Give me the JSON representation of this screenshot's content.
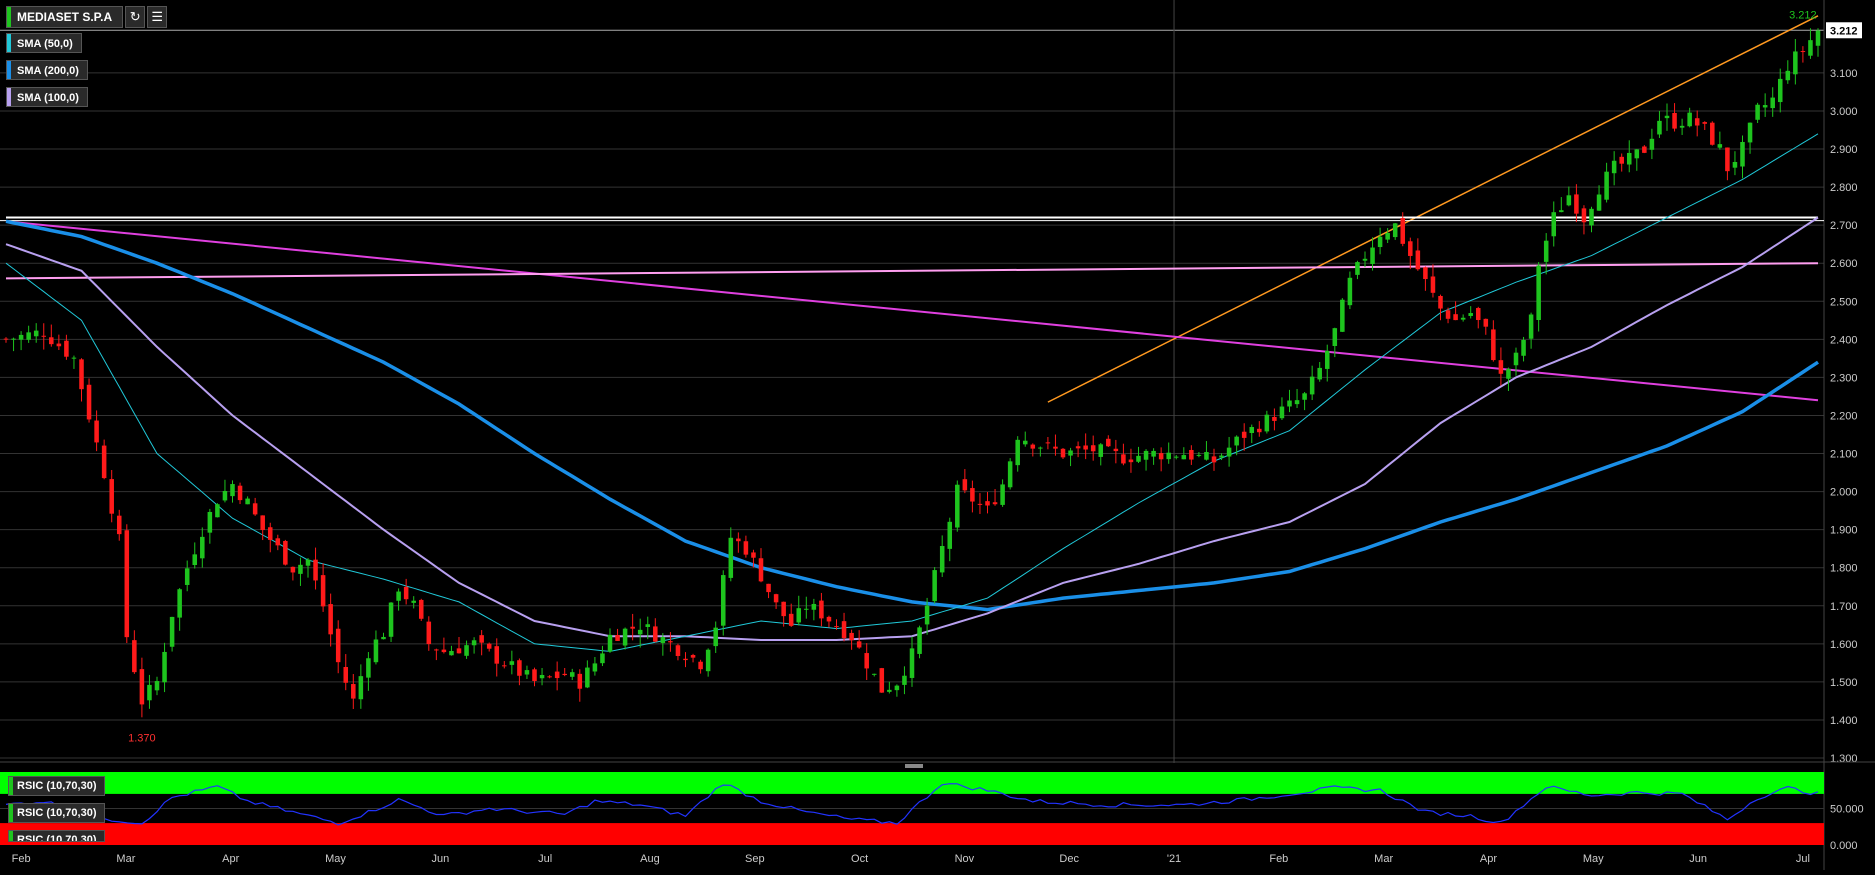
{
  "header": {
    "symbol": "MEDIASET S.P.A",
    "refresh_icon": "refresh-icon",
    "ruler_icon": "ruler-icon"
  },
  "legend": [
    {
      "label": "SMA (50,0)",
      "color": "#20c8d8"
    },
    {
      "label": "SMA (200,0)",
      "color": "#1a8fe8"
    },
    {
      "label": "SMA (100,0)",
      "color": "#b8a0f0"
    }
  ],
  "price_labels": {
    "last": "3.212",
    "high_marker": "3.212",
    "low_marker": "1.370"
  },
  "colors": {
    "up": "#1ec41e",
    "down": "#ff1a1a",
    "trend_up": "#ff9920",
    "trend_down": "#e040e0",
    "flat_line": "#ff9ef0",
    "resistance": "#ffffff",
    "rsi_line": "#2233ff",
    "rsi_overbought": "#00ff00",
    "rsi_oversold": "#ff0000"
  },
  "rsi_panel": {
    "labels": [
      "RSIC (10,70,30)",
      "RSIC (10,70,30)",
      "RSIC (10,70,30)"
    ],
    "axis": [
      "50.000",
      "0.000"
    ]
  },
  "chart_data": {
    "type": "candlestick",
    "yaxis_ticks": [
      "3.212",
      "3.100",
      "3.000",
      "2.900",
      "2.800",
      "2.700",
      "2.600",
      "2.500",
      "2.400",
      "2.300",
      "2.200",
      "2.100",
      "2.000",
      "1.900",
      "1.800",
      "1.700",
      "1.600",
      "1.500",
      "1.400",
      "1.300"
    ],
    "xaxis_ticks": [
      "Feb",
      "Mar",
      "Apr",
      "May",
      "Jun",
      "Jul",
      "Aug",
      "Sep",
      "Oct",
      "Nov",
      "Dec",
      "'21",
      "Feb",
      "Mar",
      "Apr",
      "May",
      "Jun",
      "Jul"
    ],
    "ylim": [
      1.3,
      3.26
    ],
    "close_path": [
      [
        0,
        2.4
      ],
      [
        5,
        2.42
      ],
      [
        9,
        2.35
      ],
      [
        11,
        2.2
      ],
      [
        13,
        2.05
      ],
      [
        15,
        1.87
      ],
      [
        16,
        1.62
      ],
      [
        18,
        1.45
      ],
      [
        20,
        1.5
      ],
      [
        22,
        1.68
      ],
      [
        24,
        1.8
      ],
      [
        26,
        1.9
      ],
      [
        28,
        1.98
      ],
      [
        30,
        2.02
      ],
      [
        32,
        1.97
      ],
      [
        34,
        1.9
      ],
      [
        36,
        1.85
      ],
      [
        38,
        1.8
      ],
      [
        40,
        1.82
      ],
      [
        42,
        1.7
      ],
      [
        44,
        1.55
      ],
      [
        46,
        1.45
      ],
      [
        48,
        1.58
      ],
      [
        50,
        1.63
      ],
      [
        52,
        1.75
      ],
      [
        54,
        1.7
      ],
      [
        56,
        1.6
      ],
      [
        58,
        1.58
      ],
      [
        62,
        1.6
      ],
      [
        66,
        1.55
      ],
      [
        70,
        1.5
      ],
      [
        74,
        1.52
      ],
      [
        76,
        1.5
      ],
      [
        78,
        1.55
      ],
      [
        80,
        1.62
      ],
      [
        84,
        1.65
      ],
      [
        88,
        1.6
      ],
      [
        92,
        1.55
      ],
      [
        94,
        1.65
      ],
      [
        96,
        1.88
      ],
      [
        98,
        1.85
      ],
      [
        100,
        1.78
      ],
      [
        102,
        1.7
      ],
      [
        104,
        1.65
      ],
      [
        106,
        1.7
      ],
      [
        108,
        1.68
      ],
      [
        110,
        1.65
      ],
      [
        112,
        1.62
      ],
      [
        114,
        1.55
      ],
      [
        116,
        1.48
      ],
      [
        118,
        1.5
      ],
      [
        120,
        1.57
      ],
      [
        122,
        1.7
      ],
      [
        124,
        1.85
      ],
      [
        126,
        2.0
      ],
      [
        128,
        1.98
      ],
      [
        130,
        1.95
      ],
      [
        132,
        2.02
      ],
      [
        134,
        2.15
      ],
      [
        136,
        2.13
      ],
      [
        140,
        2.1
      ],
      [
        144,
        2.11
      ],
      [
        148,
        2.09
      ],
      [
        152,
        2.1
      ],
      [
        156,
        2.1
      ],
      [
        160,
        2.08
      ],
      [
        164,
        2.15
      ],
      [
        168,
        2.2
      ],
      [
        172,
        2.25
      ],
      [
        174,
        2.32
      ],
      [
        176,
        2.42
      ],
      [
        178,
        2.55
      ],
      [
        180,
        2.62
      ],
      [
        182,
        2.68
      ],
      [
        184,
        2.7
      ],
      [
        186,
        2.62
      ],
      [
        188,
        2.55
      ],
      [
        190,
        2.48
      ],
      [
        192,
        2.45
      ],
      [
        194,
        2.47
      ],
      [
        196,
        2.42
      ],
      [
        198,
        2.3
      ],
      [
        200,
        2.35
      ],
      [
        202,
        2.45
      ],
      [
        203,
        2.6
      ],
      [
        205,
        2.72
      ],
      [
        207,
        2.78
      ],
      [
        209,
        2.72
      ],
      [
        211,
        2.8
      ],
      [
        213,
        2.85
      ],
      [
        215,
        2.87
      ],
      [
        217,
        2.9
      ],
      [
        219,
        2.98
      ],
      [
        221,
        2.97
      ],
      [
        223,
        2.98
      ],
      [
        225,
        2.95
      ],
      [
        227,
        2.9
      ],
      [
        228,
        2.85
      ],
      [
        230,
        2.9
      ],
      [
        232,
        3.0
      ],
      [
        234,
        3.03
      ],
      [
        236,
        3.12
      ],
      [
        238,
        3.16
      ],
      [
        240,
        3.212
      ]
    ],
    "sma50_path": [
      [
        0,
        2.6
      ],
      [
        10,
        2.45
      ],
      [
        20,
        2.1
      ],
      [
        30,
        1.93
      ],
      [
        40,
        1.82
      ],
      [
        50,
        1.77
      ],
      [
        60,
        1.71
      ],
      [
        70,
        1.6
      ],
      [
        80,
        1.58
      ],
      [
        90,
        1.62
      ],
      [
        100,
        1.66
      ],
      [
        110,
        1.64
      ],
      [
        120,
        1.66
      ],
      [
        130,
        1.72
      ],
      [
        140,
        1.85
      ],
      [
        150,
        1.97
      ],
      [
        160,
        2.08
      ],
      [
        170,
        2.16
      ],
      [
        180,
        2.32
      ],
      [
        190,
        2.47
      ],
      [
        200,
        2.55
      ],
      [
        210,
        2.62
      ],
      [
        220,
        2.72
      ],
      [
        230,
        2.82
      ],
      [
        240,
        2.94
      ]
    ],
    "sma100_path": [
      [
        0,
        2.65
      ],
      [
        10,
        2.58
      ],
      [
        20,
        2.38
      ],
      [
        30,
        2.2
      ],
      [
        40,
        2.05
      ],
      [
        50,
        1.9
      ],
      [
        60,
        1.76
      ],
      [
        70,
        1.66
      ],
      [
        80,
        1.62
      ],
      [
        90,
        1.62
      ],
      [
        100,
        1.61
      ],
      [
        110,
        1.61
      ],
      [
        120,
        1.62
      ],
      [
        130,
        1.68
      ],
      [
        140,
        1.76
      ],
      [
        150,
        1.81
      ],
      [
        160,
        1.87
      ],
      [
        170,
        1.92
      ],
      [
        180,
        2.02
      ],
      [
        190,
        2.18
      ],
      [
        200,
        2.3
      ],
      [
        210,
        2.38
      ],
      [
        220,
        2.49
      ],
      [
        230,
        2.59
      ],
      [
        240,
        2.72
      ]
    ],
    "sma200_path": [
      [
        0,
        2.71
      ],
      [
        10,
        2.67
      ],
      [
        20,
        2.6
      ],
      [
        30,
        2.52
      ],
      [
        40,
        2.43
      ],
      [
        50,
        2.34
      ],
      [
        60,
        2.23
      ],
      [
        70,
        2.1
      ],
      [
        80,
        1.98
      ],
      [
        90,
        1.87
      ],
      [
        100,
        1.8
      ],
      [
        110,
        1.75
      ],
      [
        120,
        1.71
      ],
      [
        130,
        1.69
      ],
      [
        140,
        1.72
      ],
      [
        150,
        1.74
      ],
      [
        160,
        1.76
      ],
      [
        170,
        1.79
      ],
      [
        180,
        1.85
      ],
      [
        190,
        1.92
      ],
      [
        200,
        1.98
      ],
      [
        210,
        2.05
      ],
      [
        220,
        2.12
      ],
      [
        230,
        2.21
      ],
      [
        240,
        2.34
      ]
    ],
    "trendlines": [
      {
        "name": "uptrend",
        "from": [
          138,
          2.235
        ],
        "to": [
          240,
          3.25
        ]
      },
      {
        "name": "downtrend",
        "from": [
          0,
          2.71
        ],
        "to": [
          240,
          2.24
        ]
      },
      {
        "name": "flat",
        "from": [
          0,
          2.56
        ],
        "to": [
          240,
          2.6
        ]
      },
      {
        "name": "resistance",
        "from": [
          0,
          2.72
        ],
        "to": [
          240,
          2.72
        ]
      }
    ],
    "rsi_path": [
      [
        0,
        55
      ],
      [
        5,
        60
      ],
      [
        10,
        45
      ],
      [
        14,
        35
      ],
      [
        18,
        30
      ],
      [
        22,
        65
      ],
      [
        28,
        80
      ],
      [
        32,
        60
      ],
      [
        38,
        45
      ],
      [
        44,
        30
      ],
      [
        48,
        45
      ],
      [
        52,
        62
      ],
      [
        58,
        40
      ],
      [
        64,
        50
      ],
      [
        70,
        45
      ],
      [
        74,
        42
      ],
      [
        78,
        60
      ],
      [
        84,
        55
      ],
      [
        90,
        40
      ],
      [
        95,
        85
      ],
      [
        100,
        60
      ],
      [
        106,
        45
      ],
      [
        112,
        35
      ],
      [
        118,
        30
      ],
      [
        124,
        85
      ],
      [
        130,
        75
      ],
      [
        136,
        60
      ],
      [
        146,
        55
      ],
      [
        156,
        55
      ],
      [
        164,
        62
      ],
      [
        170,
        70
      ],
      [
        176,
        78
      ],
      [
        182,
        75
      ],
      [
        188,
        45
      ],
      [
        194,
        40
      ],
      [
        198,
        30
      ],
      [
        204,
        80
      ],
      [
        210,
        68
      ],
      [
        216,
        72
      ],
      [
        222,
        70
      ],
      [
        228,
        35
      ],
      [
        232,
        65
      ],
      [
        236,
        78
      ],
      [
        240,
        70
      ]
    ],
    "rsi_levels": {
      "overbought": 70,
      "oversold": 30
    }
  }
}
